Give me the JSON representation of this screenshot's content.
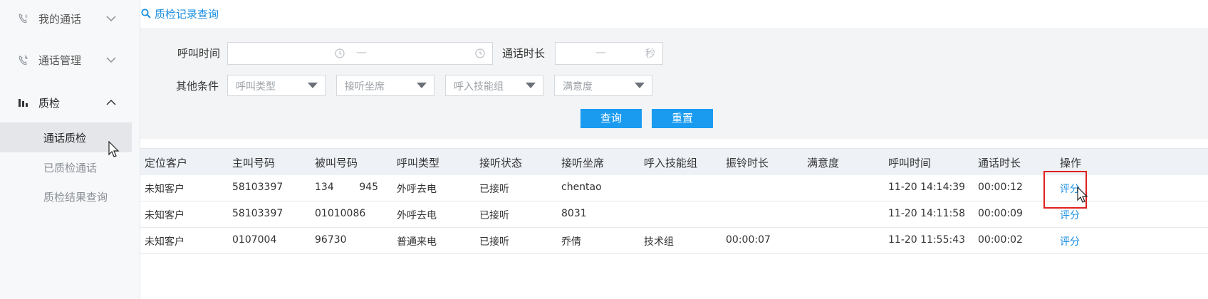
{
  "sidebar": {
    "groups": [
      {
        "label": "我的通话"
      },
      {
        "label": "通话管理"
      },
      {
        "label": "质检"
      }
    ],
    "sub_items": [
      {
        "label": "通话质检"
      },
      {
        "label": "已质检通话"
      },
      {
        "label": "质检结果查询"
      }
    ]
  },
  "page": {
    "title": "质检记录查询"
  },
  "filters": {
    "call_time_label": "呼叫时间",
    "date_separator": "—",
    "duration_label": "通话时长",
    "duration_separator": "—",
    "duration_unit": "秒",
    "other_label": "其他条件",
    "selects": [
      {
        "placeholder": "呼叫类型"
      },
      {
        "placeholder": "接听坐席"
      },
      {
        "placeholder": "呼入技能组"
      },
      {
        "placeholder": "满意度"
      }
    ],
    "query_label": "查询",
    "reset_label": "重置"
  },
  "table": {
    "columns": [
      "定位客户",
      "主叫号码",
      "被叫号码",
      "呼叫类型",
      "接听状态",
      "接听坐席",
      "呼入技能组",
      "振铃时长",
      "满意度",
      "呼叫时间",
      "通话时长",
      "操作"
    ],
    "rows": [
      [
        "未知客户",
        "58103397",
        "134        945",
        "外呼去电",
        "已接听",
        "chentao",
        "",
        "",
        "",
        "11-20 14:14:39",
        "00:00:12",
        "评分"
      ],
      [
        "未知客户",
        "58103397",
        "01010086",
        "外呼去电",
        "已接听",
        "8031",
        "",
        "",
        "",
        "11-20 14:11:58",
        "00:00:09",
        "评分"
      ],
      [
        "未知客户",
        "0107004",
        "96730",
        "普通来电",
        "已接听",
        "乔倩",
        "技术组",
        "00:00:07",
        "",
        "11-20 11:55:43",
        "00:00:02",
        "评分"
      ]
    ]
  },
  "colors": {
    "accent": "#1a9bf0",
    "link": "#1a8fe3",
    "highlight": "#e02020"
  }
}
